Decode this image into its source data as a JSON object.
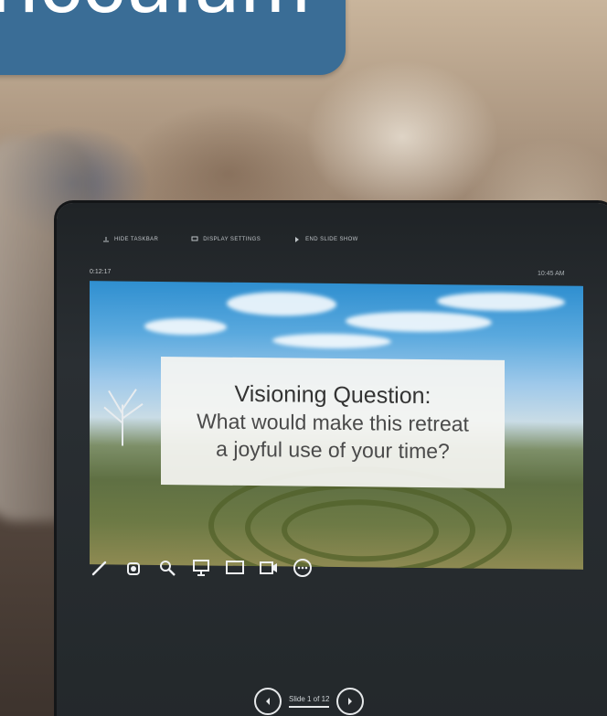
{
  "banner": {
    "text": "ricculum",
    "color": "#3a6d96"
  },
  "presenter": {
    "toolbar": {
      "items": [
        {
          "label": "HIDE TASKBAR",
          "icon": "taskbar-icon"
        },
        {
          "label": "DISPLAY SETTINGS",
          "icon": "display-settings-icon"
        },
        {
          "label": "END SLIDE SHOW",
          "icon": "end-show-icon"
        }
      ]
    },
    "timer": "0:12:17",
    "clock": "10:45 AM",
    "slide": {
      "title": "Visioning Question:",
      "line2": "What would make this retreat",
      "line3": "a joyful use of your time?"
    },
    "tools": [
      "pen-icon",
      "laser-icon",
      "zoom-icon",
      "present-icon",
      "screen-icon",
      "video-icon",
      "more-icon"
    ],
    "nav": {
      "label": "Slide 1 of 12"
    }
  }
}
